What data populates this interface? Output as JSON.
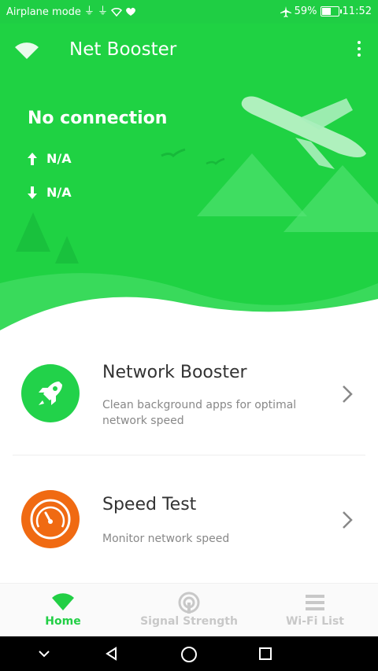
{
  "status_bar": {
    "mode_text": "Airplane mode",
    "battery_percent": "59%",
    "battery_level": 0.59,
    "time": "11:52",
    "icons": [
      "usb-icon",
      "usb-icon",
      "wifi-icon",
      "heart-icon",
      "airplane-icon",
      "battery-icon"
    ]
  },
  "app_bar": {
    "title": "Net Booster",
    "icons": [
      "wifi-logo-icon",
      "more-vert-icon"
    ]
  },
  "connection": {
    "status": "No connection",
    "upload": "N/A",
    "download": "N/A"
  },
  "features": [
    {
      "title": "Network Booster",
      "description": "Clean background apps for optimal network speed",
      "icon": "rocket-icon",
      "color": "#22d24a"
    },
    {
      "title": "Speed Test",
      "description": "Monitor network speed",
      "icon": "speedometer-icon",
      "color": "#f06a12"
    }
  ],
  "bottom_nav": {
    "tabs": [
      {
        "label": "Home",
        "icon": "wifi-icon",
        "active": true
      },
      {
        "label": "Signal Strength",
        "icon": "signal-icon",
        "active": false
      },
      {
        "label": "Wi-Fi List",
        "icon": "list-icon",
        "active": false
      }
    ],
    "active_color": "#22cf45",
    "inactive_color": "#c8c8c8"
  },
  "colors": {
    "brand_green": "#1fd243"
  }
}
